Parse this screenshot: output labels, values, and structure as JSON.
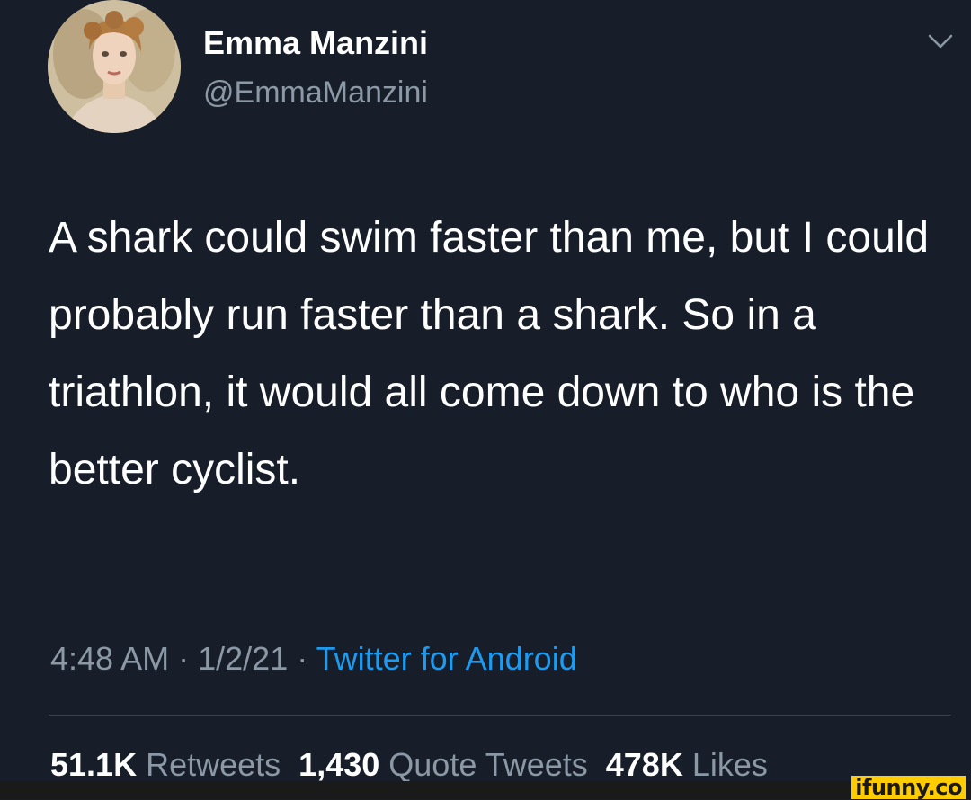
{
  "user": {
    "display_name": "Emma Manzini",
    "handle": "@EmmaManzini"
  },
  "tweet": {
    "text": "A shark could swim faster than me, but I could probably run faster than a shark. So in a triathlon, it would all come down to who is the better cyclist.",
    "time": "4:48 AM",
    "separator": "·",
    "date": "1/2/21",
    "source": "Twitter for Android"
  },
  "stats": {
    "retweets_count": "51.1K",
    "retweets_label": "Retweets",
    "quotes_count": "1,430",
    "quotes_label": "Quote Tweets",
    "likes_count": "478K",
    "likes_label": "Likes"
  },
  "watermark": {
    "text": "ifunny.co"
  },
  "colors": {
    "background": "#171e29",
    "primary_text": "#ffffff",
    "secondary_text": "#8b98a5",
    "link": "#1d9bf0",
    "watermark_bg": "#ffcc00"
  },
  "icons": {
    "more": "chevron-down-icon"
  }
}
